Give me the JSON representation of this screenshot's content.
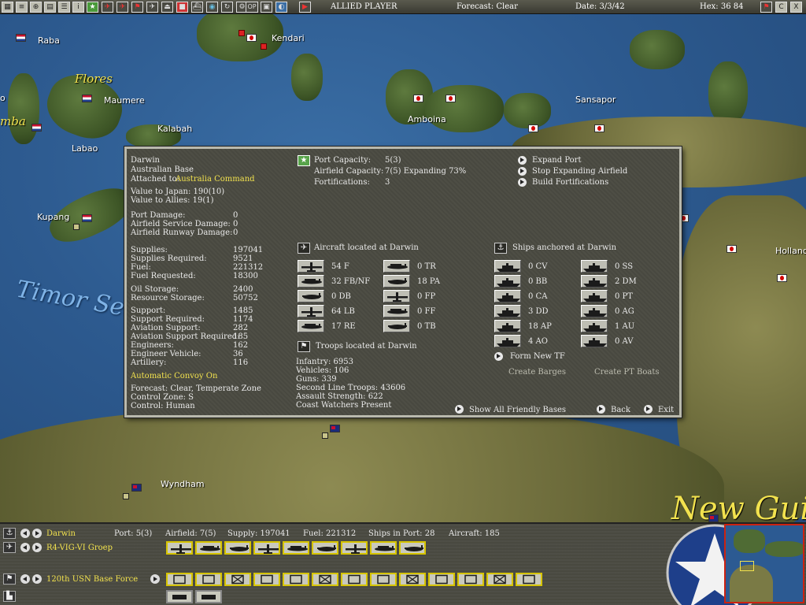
{
  "topbar": {
    "player": "ALLIED PLAYER",
    "forecast": "Forecast: Clear",
    "date": "Date: 3/3/42",
    "hex": "Hex: 36 84",
    "right_buttons": [
      "C",
      "X"
    ],
    "icon_buttons": [
      "OP"
    ]
  },
  "map": {
    "places": {
      "raba": "Raba",
      "flores": "Flores",
      "maumere": "Maumere",
      "kendari": "Kendari",
      "kalabah": "Kalabah",
      "labao": "Labao",
      "amboina": "Amboina",
      "sansapor": "Sansapor",
      "kupang": "Kupang",
      "timor_sea": "Timor Sea",
      "wyndham": "Wyndham",
      "hollandia": "Hollandia",
      "new_guinea": "New Gui",
      "sumba": "mba",
      "o_frag": "o"
    }
  },
  "base": {
    "name": "Darwin",
    "type": "Australian Base",
    "attached_label": "Attached to:",
    "attached_value": "Australia Command",
    "value_japan": "Value to Japan: 190(10)",
    "value_allies": "Value to Allies: 19(1)",
    "damage": [
      {
        "label": "Port Damage:",
        "value": "0"
      },
      {
        "label": "Airfield Service Damage:",
        "value": "0"
      },
      {
        "label": "Airfield Runway Damage:",
        "value": "0"
      }
    ],
    "supplies": [
      {
        "label": "Supplies:",
        "value": "197041"
      },
      {
        "label": "Supplies Required:",
        "value": "9521"
      },
      {
        "label": "Fuel:",
        "value": "221312"
      },
      {
        "label": "Fuel Requested:",
        "value": "18300"
      }
    ],
    "storage": [
      {
        "label": "Oil Storage:",
        "value": "2400"
      },
      {
        "label": "Resource Storage:",
        "value": "50752"
      }
    ],
    "support": [
      {
        "label": "Support:",
        "value": "1485"
      },
      {
        "label": "Support Required:",
        "value": "1174"
      },
      {
        "label": "Aviation Support:",
        "value": "282"
      },
      {
        "label": "Aviation Support Required:",
        "value": "185"
      },
      {
        "label": "Engineers:",
        "value": "162"
      },
      {
        "label": "Engineer Vehicle:",
        "value": "36"
      },
      {
        "label": "Artillery:",
        "value": "116"
      }
    ],
    "convoy": "Automatic Convoy On",
    "forecast": "Forecast: Clear, Temperate Zone",
    "control_zone": "Control Zone: S",
    "control": "Control:    Human",
    "port_capacity_label": "Port Capacity:",
    "port_capacity_value": "5(3)",
    "airfield_capacity_label": "Airfield Capacity:",
    "airfield_capacity_value": "7(5) Expanding 73%",
    "fortifications_label": "Fortifications:",
    "fortifications_value": "3",
    "actions": [
      "Expand Port",
      "Stop Expanding Airfield",
      "Build Fortifications"
    ],
    "aircraft_header": "Aircraft located at Darwin",
    "aircraft_left": [
      "54 F",
      "32 FB/NF",
      "0 DB",
      "64 LB",
      "17 RE"
    ],
    "aircraft_right": [
      "0 TR",
      "18 PA",
      "0 FP",
      "0 FF",
      "0 TB"
    ],
    "ships_header": "Ships anchored at Darwin",
    "ships_left": [
      "0 CV",
      "0 BB",
      "0 CA",
      "3 DD",
      "18 AP",
      "4 AO"
    ],
    "ships_right": [
      "0 SS",
      "2 DM",
      "0 PT",
      "0 AG",
      "1 AU",
      "0 AV"
    ],
    "form_tf": "Form New TF",
    "create_barges": "Create Barges",
    "create_pt": "Create PT Boats",
    "troops_header": "Troops located at Darwin",
    "troops": [
      "Infantry: 6953",
      "Vehicles: 106",
      "Guns: 339",
      "Second Line Troops: 43606",
      "Assault Strength: 622",
      "Coast Watchers Present"
    ],
    "show_bases": "Show All Friendly Bases",
    "back": "Back",
    "exit": "Exit"
  },
  "bottom": {
    "base_name": "Darwin",
    "port": "Port: 5(3)",
    "airfield": "Airfield: 7(5)",
    "supply": "Supply: 197041",
    "fuel": "Fuel: 221312",
    "ships_in_port": "Ships in Port: 28",
    "aircraft": "Aircraft: 185",
    "air_unit": "R4-VIG-VI Groep",
    "ground_unit": "120th USN Base Force"
  }
}
